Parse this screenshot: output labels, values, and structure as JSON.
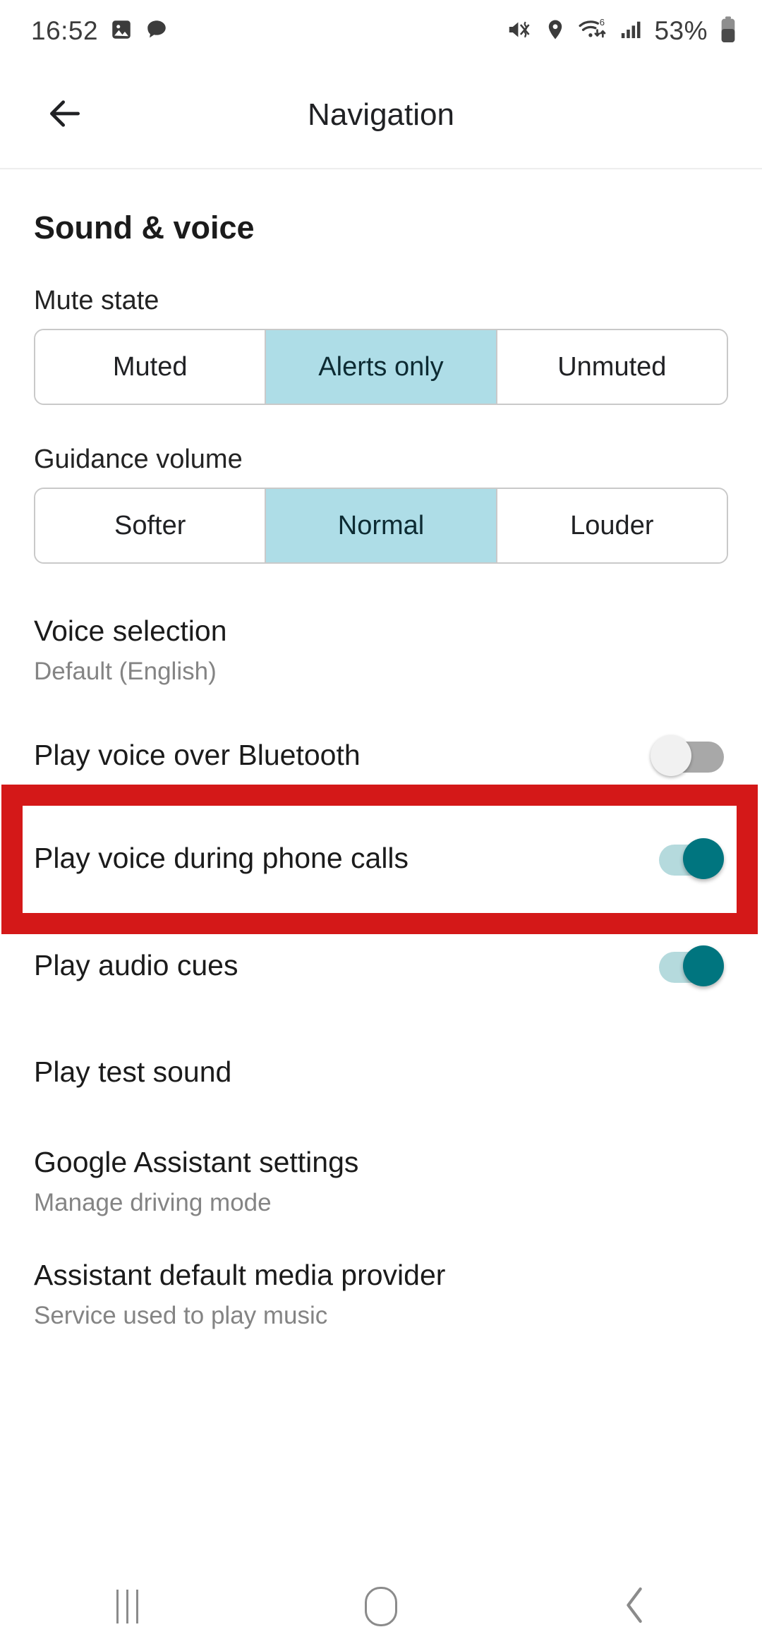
{
  "status_bar": {
    "time": "16:52",
    "battery_percent": "53%",
    "left_icons": [
      "gallery-image-icon",
      "chat-bubble-icon"
    ],
    "right_icons": [
      "mute-vibrate-icon",
      "location-pin-icon",
      "wifi-6-icon",
      "cellular-signal-icon",
      "battery-icon"
    ]
  },
  "header": {
    "title": "Navigation",
    "back_label": "Back"
  },
  "section": {
    "title": "Sound & voice"
  },
  "mute_state": {
    "label": "Mute state",
    "options": [
      "Muted",
      "Alerts only",
      "Unmuted"
    ],
    "selected": "Alerts only"
  },
  "guidance_volume": {
    "label": "Guidance volume",
    "options": [
      "Softer",
      "Normal",
      "Louder"
    ],
    "selected": "Normal"
  },
  "items": {
    "voice_selection": {
      "title": "Voice selection",
      "subtitle": "Default (English)"
    },
    "play_voice_over_bluetooth": {
      "title": "Play voice over Bluetooth",
      "toggle_state": "off"
    },
    "play_voice_during_calls": {
      "title": "Play voice during phone calls",
      "toggle_state": "on"
    },
    "play_audio_cues": {
      "title": "Play audio cues",
      "toggle_state": "on"
    },
    "play_test_sound": {
      "title": "Play test sound"
    },
    "google_assistant_settings": {
      "title": "Google Assistant settings",
      "subtitle": "Manage driving mode"
    },
    "assistant_media_provider": {
      "title": "Assistant default media provider",
      "subtitle": "Service used to play music"
    }
  },
  "nav_bar": {
    "recents_label": "Recents",
    "home_label": "Home",
    "back_label": "Back"
  },
  "colors": {
    "accent_teal": "#00757f",
    "segment_selected": "#aedde7",
    "annotation_red": "#d41818",
    "toggle_off_track": "#a8a8a8",
    "subtitle_gray": "#848484"
  }
}
